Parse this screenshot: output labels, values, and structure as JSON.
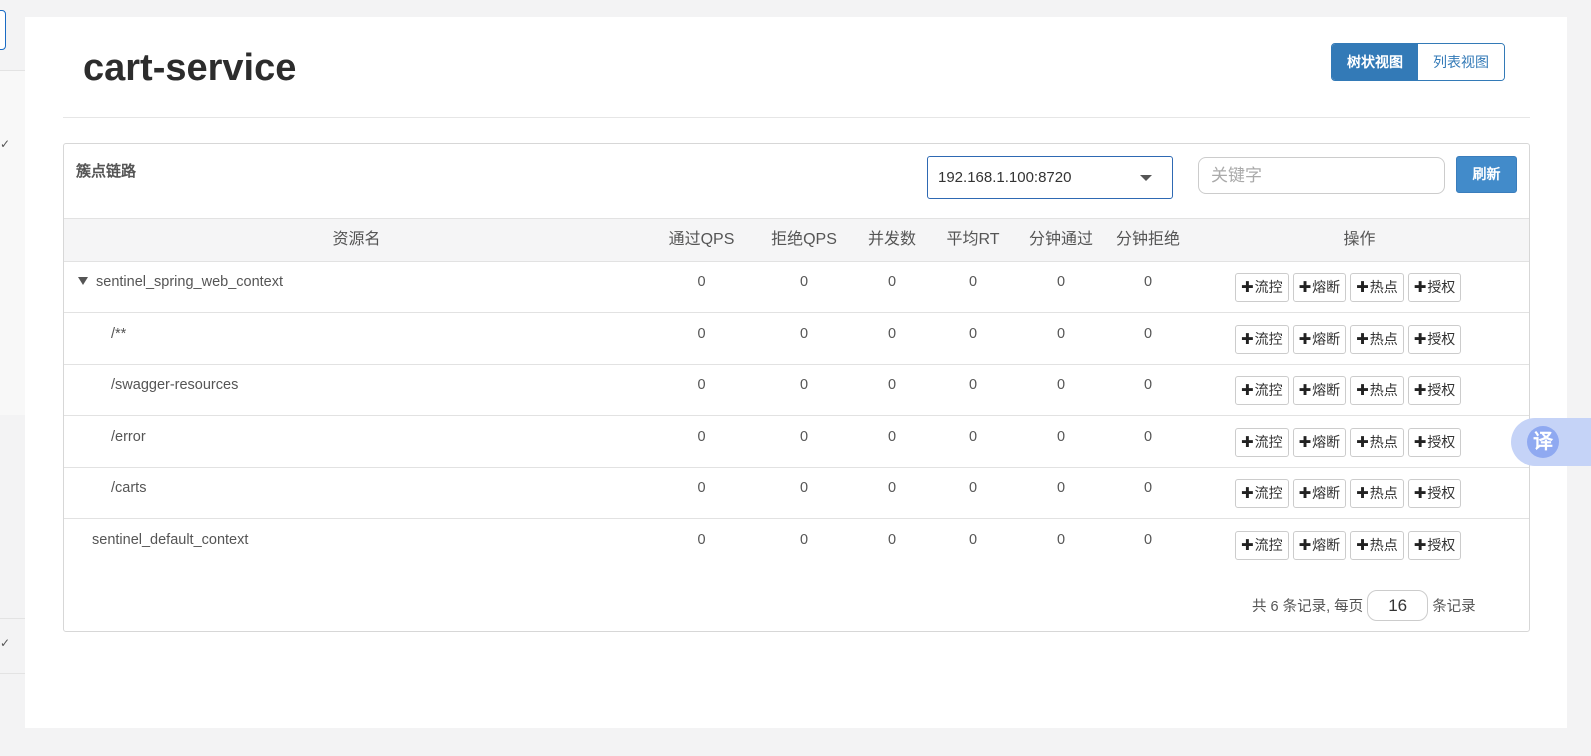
{
  "page": {
    "title": "cart-service"
  },
  "view_toggle": {
    "tree_label": "树状视图",
    "list_label": "列表视图",
    "active": "tree"
  },
  "panel": {
    "title": "簇点链路",
    "machine_select": {
      "value": "192.168.1.100:8720"
    },
    "keyword_input": {
      "placeholder": "关键字",
      "value": ""
    },
    "refresh_label": "刷新"
  },
  "table": {
    "headers": {
      "resource": "资源名",
      "pass_qps": "通过QPS",
      "block_qps": "拒绝QPS",
      "threads": "并发数",
      "avg_rt": "平均RT",
      "minute_pass": "分钟通过",
      "minute_block": "分钟拒绝",
      "actions": "操作"
    },
    "action_labels": {
      "flow": "流控",
      "degrade": "熔断",
      "hotspot": "热点",
      "authority": "授权"
    },
    "rows": [
      {
        "name": "sentinel_spring_web_context",
        "pass_qps": "0",
        "block_qps": "0",
        "threads": "0",
        "avg_rt": "0",
        "minute_pass": "0",
        "minute_block": "0"
      },
      {
        "name": "/**",
        "pass_qps": "0",
        "block_qps": "0",
        "threads": "0",
        "avg_rt": "0",
        "minute_pass": "0",
        "minute_block": "0"
      },
      {
        "name": "/swagger-resources",
        "pass_qps": "0",
        "block_qps": "0",
        "threads": "0",
        "avg_rt": "0",
        "minute_pass": "0",
        "minute_block": "0"
      },
      {
        "name": "/error",
        "pass_qps": "0",
        "block_qps": "0",
        "threads": "0",
        "avg_rt": "0",
        "minute_pass": "0",
        "minute_block": "0"
      },
      {
        "name": "/carts",
        "pass_qps": "0",
        "block_qps": "0",
        "threads": "0",
        "avg_rt": "0",
        "minute_pass": "0",
        "minute_block": "0"
      },
      {
        "name": "sentinel_default_context",
        "pass_qps": "0",
        "block_qps": "0",
        "threads": "0",
        "avg_rt": "0",
        "minute_pass": "0",
        "minute_block": "0"
      }
    ]
  },
  "pager": {
    "total_text": "共 6 条记录, 每页",
    "page_size": "16",
    "suffix_text": "条记录"
  },
  "translate_fab": {
    "label": "译"
  },
  "colors": {
    "primary": "#337ab7",
    "refresh": "#428bca",
    "translate": "#8fa9f1"
  }
}
